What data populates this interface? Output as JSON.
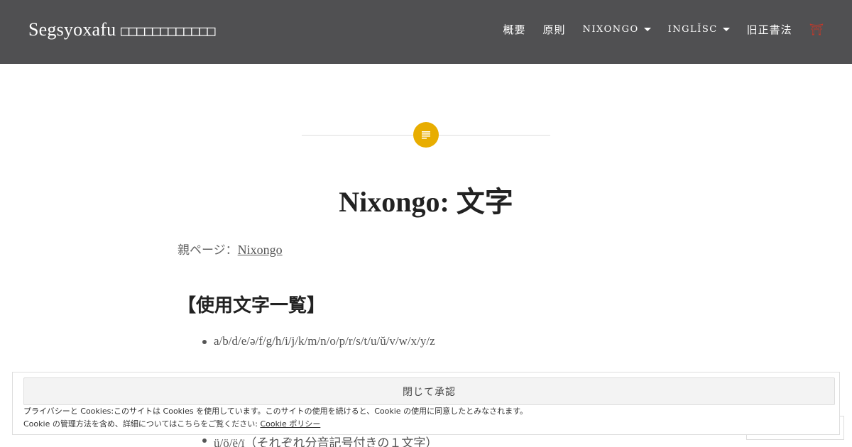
{
  "site": {
    "title": "Segsyoxafu",
    "title_boxes": "□□□□□□□□□□□□"
  },
  "nav": {
    "items": [
      {
        "label": "概要"
      },
      {
        "label": "原則"
      },
      {
        "label": "NIXONGO"
      },
      {
        "label": "INGLǏSC"
      },
      {
        "label": "旧正書法"
      }
    ],
    "torii_icon": "⛩"
  },
  "post": {
    "icon": "post-format-standard-icon",
    "accent_color": "#e8ad00",
    "title": "Nixongo: 文字",
    "breadcrumb_prefix": "親ページ：",
    "breadcrumb_link": "Nixongo"
  },
  "content": {
    "heading": "【使用文字一覧】",
    "items": [
      "a/b/d/e/ə/f/g/h/i/j/k/m/n/o/p/r/s/t/u/ŭ/v/w/x/y/z"
    ],
    "bottom_item": "ü/ö/ë/ï（それぞれ分音記号付きの１文字）"
  },
  "cookie": {
    "button_label": "閉じて承認",
    "line1": "プライバシーと Cookies:このサイトは Cookies を使用しています。このサイトの使用を続けると、Cookie の使用に同意したとみなされます。",
    "line2_prefix": "Cookie の管理方法を含め、詳細についてはこちらをご覧ください: ",
    "line2_link": "Cookie ポリシー"
  }
}
